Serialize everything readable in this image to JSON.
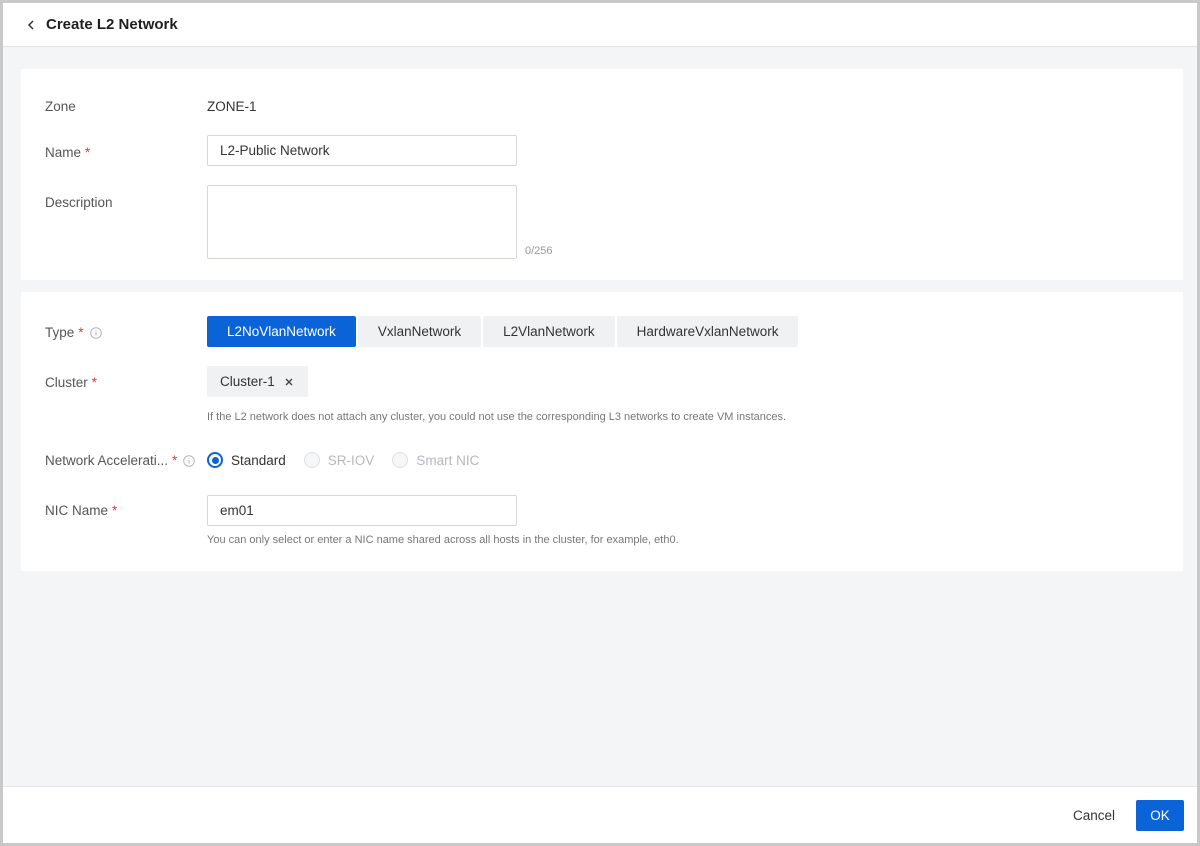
{
  "header": {
    "title": "Create L2 Network",
    "back_icon": "chevron-left-icon"
  },
  "basic": {
    "zone_label": "Zone",
    "zone_value": "ZONE-1",
    "name_label": "Name",
    "name_value": "L2-Public Network",
    "description_label": "Description",
    "description_value": "",
    "description_counter": "0/256"
  },
  "config": {
    "type_label": "Type",
    "type_options": [
      "L2NoVlanNetwork",
      "VxlanNetwork",
      "L2VlanNetwork",
      "HardwareVxlanNetwork"
    ],
    "type_selected": "L2NoVlanNetwork",
    "cluster_label": "Cluster",
    "cluster_tag": "Cluster-1",
    "cluster_hint": "If the L2 network does not attach any cluster, you could not use the corresponding L3 networks to create VM instances.",
    "accel_label": "Network Accelerati...",
    "accel_options": [
      "Standard",
      "SR-IOV",
      "Smart NIC"
    ],
    "accel_selected": "Standard",
    "nic_label": "NIC Name",
    "nic_value": "em01",
    "nic_hint": "You can only select or enter a NIC name shared across all hosts in the cluster, for example, eth0."
  },
  "footer": {
    "cancel_label": "Cancel",
    "ok_label": "OK"
  },
  "colors": {
    "accent": "#0b63d8",
    "required": "#e5392d",
    "page_bg": "#f4f5f7"
  }
}
